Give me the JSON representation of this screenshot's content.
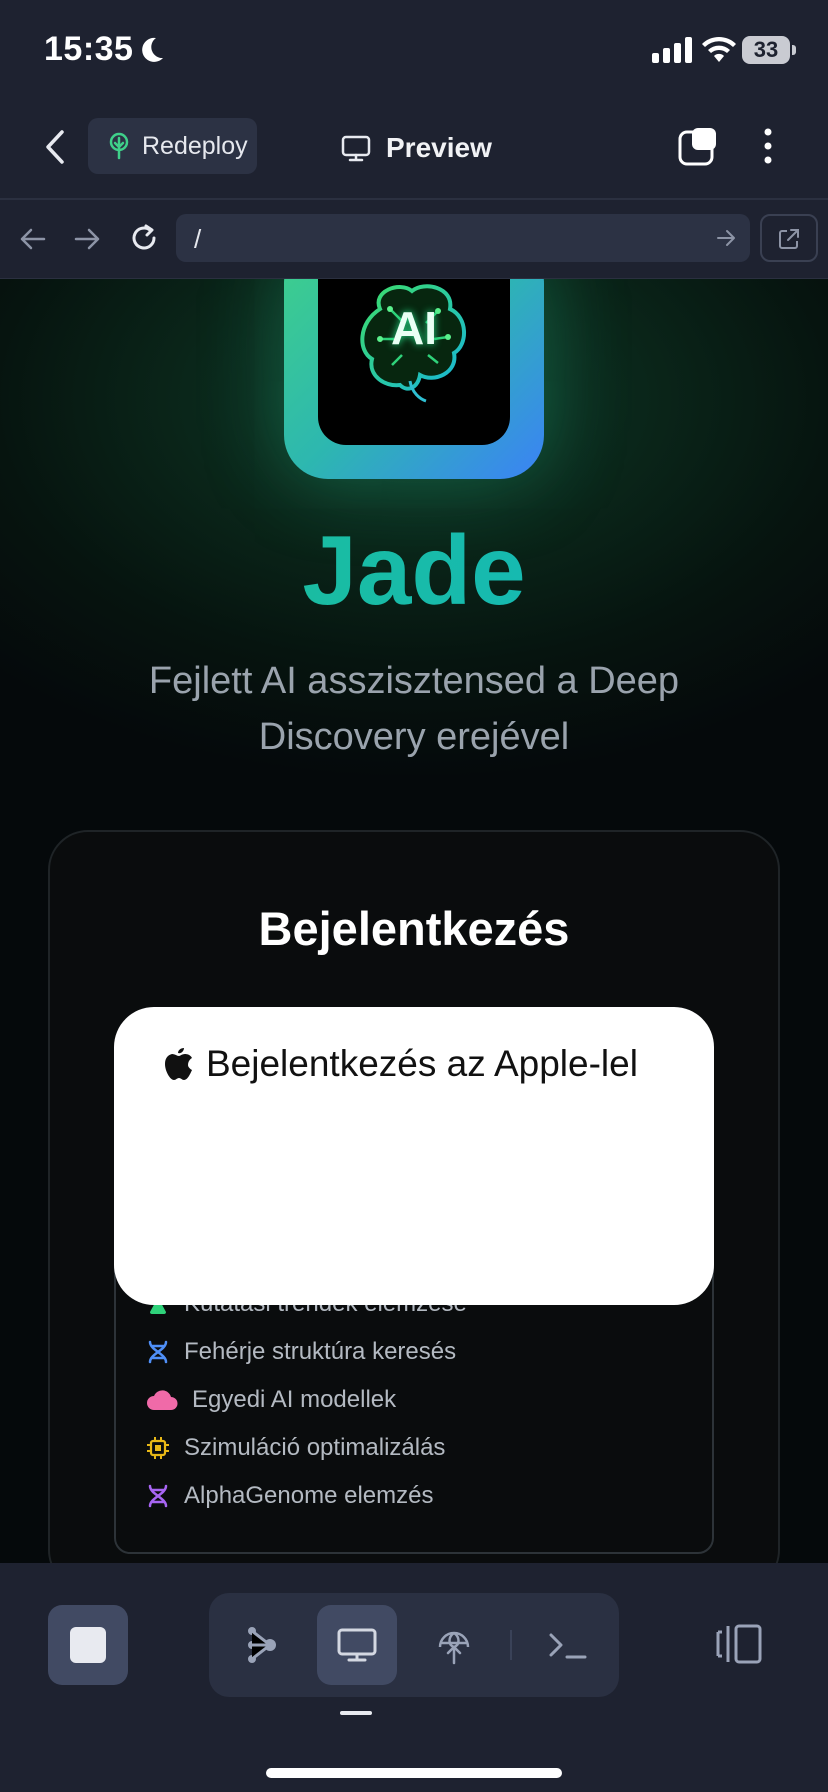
{
  "status": {
    "time": "15:35",
    "battery": "33"
  },
  "header": {
    "redeploy_label": "Redeploy",
    "preview_label": "Preview"
  },
  "urlbar": {
    "url": "/"
  },
  "app": {
    "title": "Jade",
    "subtitle": "Fejlett AI asszisztensed a Deep Discovery erejével",
    "logo_text": "AI"
  },
  "login": {
    "title": "Bejelentkezés",
    "apple_button": "Bejelentkezés az Apple-lel"
  },
  "features": [
    {
      "label": "Kutatási trendek elemzése",
      "icon": "flask-icon"
    },
    {
      "label": "Fehérje struktúra keresés",
      "icon": "dna-icon"
    },
    {
      "label": "Egyedi AI modellek",
      "icon": "cloud-icon"
    },
    {
      "label": "Szimuláció optimalizálás",
      "icon": "chip-icon"
    },
    {
      "label": "AlphaGenome elemzés",
      "icon": "dna-icon"
    }
  ],
  "colors": {
    "accent_green": "#1fbf8e",
    "accent_teal": "#11b7c4",
    "toolbar_bg": "#1e2230"
  }
}
